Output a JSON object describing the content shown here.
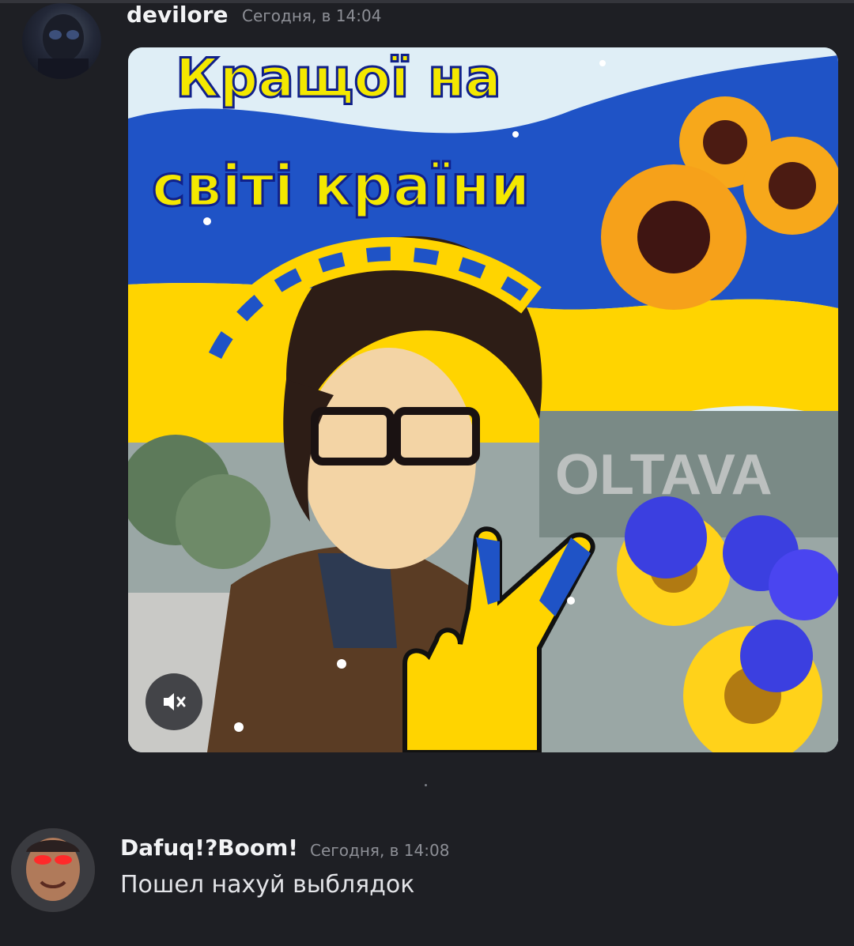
{
  "messages": [
    {
      "username": "devilore",
      "timestamp": "Сегодня, в 14:04",
      "attachment": {
        "caption_line1": "Кращої на",
        "caption_line2": "світі країни",
        "sign_text": "OLTAVA",
        "mute_icon": "speaker-muted-icon"
      }
    },
    {
      "username": "Dafuq!?Boom!",
      "timestamp": "Сегодня, в 14:08",
      "text": "Пошел нахуй выблядок"
    }
  ],
  "colors": {
    "background": "#1e1f24",
    "username": "#f2f3f5",
    "timestamp": "#8d8f96",
    "text": "#e3e4e8",
    "flag_blue": "#1f53c6",
    "flag_yellow": "#ffd400"
  }
}
